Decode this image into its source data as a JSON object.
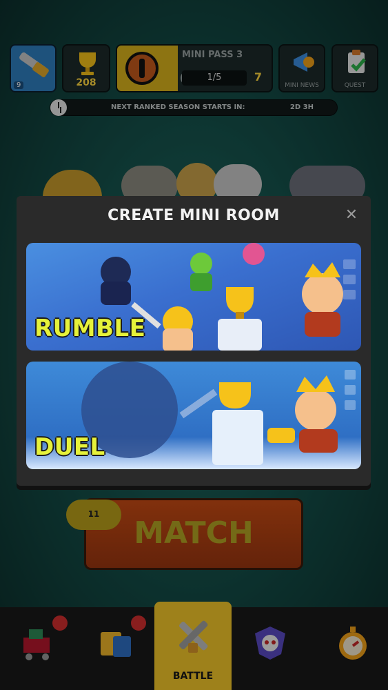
{
  "hud": {
    "level": "9",
    "trophies": "208",
    "mini_pass_title": "MINI PASS 3",
    "mini_pass_progress": "1/5",
    "mini_pass_level": "7",
    "news_label": "MINI NEWS",
    "quest_label": "QUEST"
  },
  "season": {
    "text": "NEXT RANKED SEASON STARTS IN:",
    "time": "2D 3H"
  },
  "modal": {
    "title": "CREATE MINI ROOM",
    "close_icon": "close-icon",
    "modes": [
      {
        "label": "RUMBLE"
      },
      {
        "label": "DUEL"
      }
    ]
  },
  "match": {
    "label": "MATCH",
    "badge": "11"
  },
  "nav": {
    "battle_label": "BATTLE"
  },
  "colors": {
    "accent_yellow": "#e6f23a",
    "nav_active": "#f3c72a",
    "notification": "#d32f2f"
  }
}
